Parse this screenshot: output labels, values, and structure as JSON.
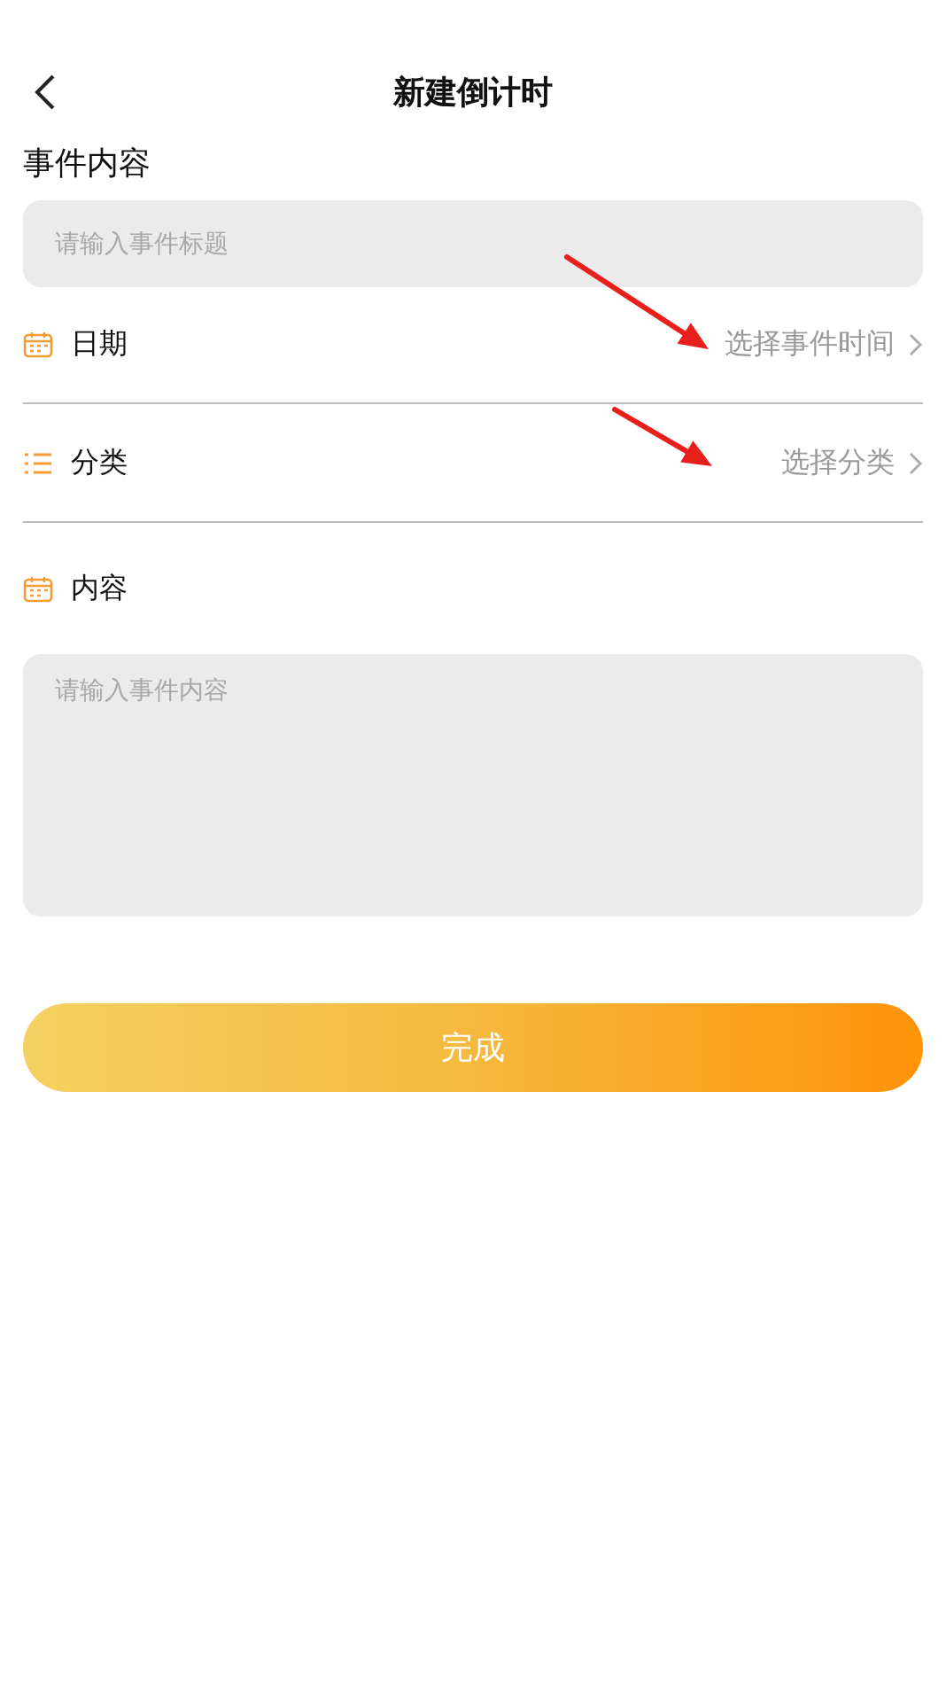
{
  "header": {
    "title": "新建倒计时"
  },
  "section_label": "事件内容",
  "title_field": {
    "placeholder": "请输入事件标题"
  },
  "rows": [
    {
      "label": "日期",
      "value": "选择事件时间"
    },
    {
      "label": "分类",
      "value": "选择分类"
    }
  ],
  "content_label": "内容",
  "content_field": {
    "placeholder": "请输入事件内容"
  },
  "submit_button": "完成"
}
